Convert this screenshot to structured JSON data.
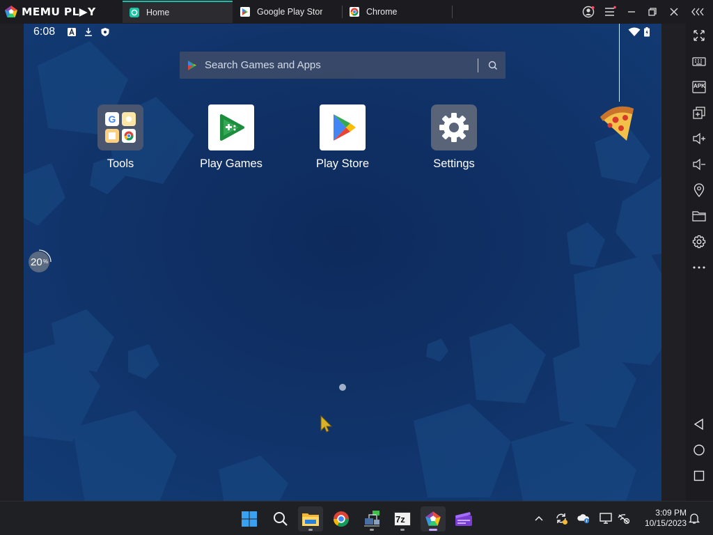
{
  "titlebar": {
    "logo_text": "MEMU PL▶Y",
    "tabs": [
      {
        "label": "Home",
        "active": true
      },
      {
        "label": "Google Play Store",
        "active": false
      },
      {
        "label": "Chrome",
        "active": false
      }
    ],
    "buttons": [
      "account-icon",
      "menu-icon",
      "minimize-icon",
      "restore-icon",
      "close-icon",
      "collapse-sidebar-icon"
    ]
  },
  "statusbar": {
    "time": "6:08",
    "left_icons": [
      "font-icon",
      "download-icon",
      "shield-icon"
    ],
    "right_icons": [
      "wifi-icon",
      "battery-icon"
    ]
  },
  "search": {
    "placeholder": "Search Games and Apps"
  },
  "apps": [
    {
      "label": "Tools",
      "icon": "tools-folder-icon"
    },
    {
      "label": "Play Games",
      "icon": "play-games-icon"
    },
    {
      "label": "Play Store",
      "icon": "play-store-icon"
    },
    {
      "label": "Settings",
      "icon": "settings-gear-icon"
    }
  ],
  "boost": {
    "value": "20",
    "unit": "%"
  },
  "sidebar": {
    "buttons": [
      "fullscreen-icon",
      "keyboard-icon",
      "apk-icon",
      "multi-instance-icon",
      "volume-up-icon",
      "volume-down-icon",
      "location-icon",
      "folder-icon",
      "settings-icon",
      "more-icon",
      "back-icon",
      "home-icon",
      "recents-icon"
    ],
    "apk_label": "APK"
  },
  "taskbar": {
    "apps": [
      "windows-start-icon",
      "search-icon",
      "file-explorer-icon",
      "chrome-icon",
      "network-app-icon",
      "7zip-icon",
      "memu-icon",
      "video-editor-icon"
    ],
    "sevenzip_label": "7z",
    "tray": [
      "chevron-up-icon",
      "sync-icon",
      "onedrive-icon",
      "display-icon",
      "network-off-icon"
    ],
    "time": "3:09 PM",
    "date": "10/15/2023"
  },
  "colors": {
    "accent": "#16c0a8",
    "screen_bg": "#0f2f63",
    "titlebar_bg": "#1c1c20",
    "taskbar_bg": "#1f2024"
  }
}
